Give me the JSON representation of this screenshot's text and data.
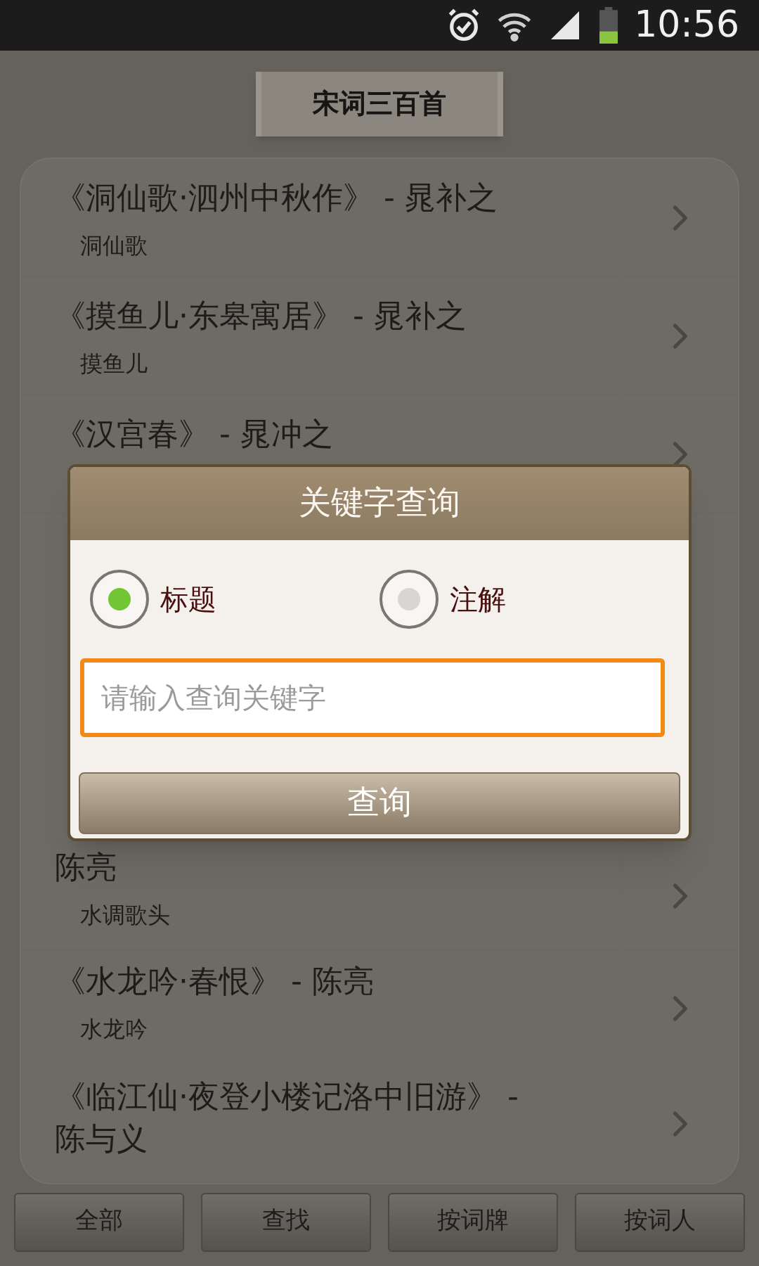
{
  "status_bar": {
    "time": "10:56"
  },
  "header": {
    "title": "宋词三百首"
  },
  "poems_above_dialog": [
    {
      "title": "《洞仙歌·泗州中秋作》 - 晁补之",
      "subtitle": "洞仙歌"
    },
    {
      "title": "《摸鱼儿·东皋寓居》 - 晁补之",
      "subtitle": "摸鱼儿"
    },
    {
      "title": "《汉宫春》 - 晁冲之"
    }
  ],
  "poems_below_dialog": [
    {
      "title": "陈亮",
      "subtitle": "水调歌头"
    },
    {
      "title": "《水龙吟·春恨》 - 陈亮",
      "subtitle": "水龙吟"
    },
    {
      "title": "《临江仙·夜登小楼记洛中旧游》 - 陈与义"
    }
  ],
  "dialog": {
    "title": "关键字查询",
    "options": [
      {
        "label": "标题",
        "selected": true
      },
      {
        "label": "注解",
        "selected": false
      }
    ],
    "search": {
      "placeholder": "请输入查询关键字"
    },
    "button": "查询"
  },
  "bottom_buttons": [
    "全部",
    "查找",
    "按词牌",
    "按词人"
  ]
}
